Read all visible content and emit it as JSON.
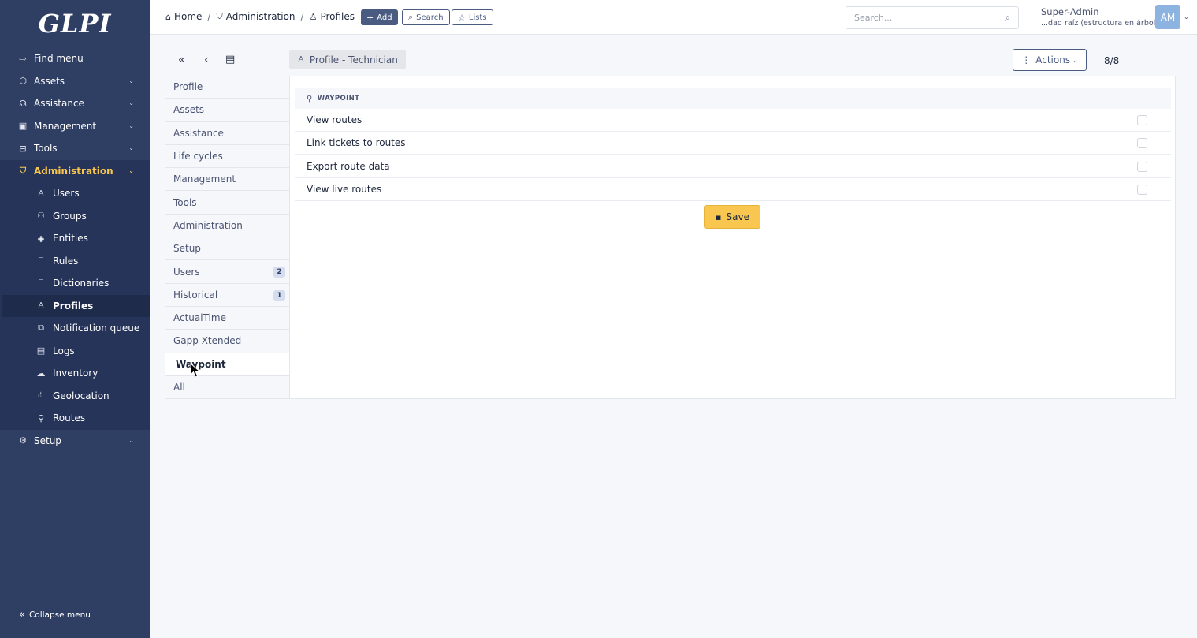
{
  "sidebar": {
    "logo": "GLPI",
    "items": [
      {
        "label": "Find menu",
        "icon": "arrow-icon",
        "glyph": "⇨",
        "chevron": false
      },
      {
        "label": "Assets",
        "icon": "box-icon",
        "glyph": "⬡",
        "chevron": true
      },
      {
        "label": "Assistance",
        "icon": "headset-icon",
        "glyph": "☊",
        "chevron": true
      },
      {
        "label": "Management",
        "icon": "wallet-icon",
        "glyph": "▣",
        "chevron": true
      },
      {
        "label": "Tools",
        "icon": "briefcase-icon",
        "glyph": "⊟",
        "chevron": true
      },
      {
        "label": "Administration",
        "icon": "shield-icon",
        "glyph": "⛉",
        "chevron": true,
        "active": true
      }
    ],
    "submenu": [
      {
        "label": "Users",
        "icon": "user-icon",
        "glyph": "♙"
      },
      {
        "label": "Groups",
        "icon": "users-icon",
        "glyph": "⚇"
      },
      {
        "label": "Entities",
        "icon": "layers-icon",
        "glyph": "◈"
      },
      {
        "label": "Rules",
        "icon": "book-icon",
        "glyph": "⎕"
      },
      {
        "label": "Dictionaries",
        "icon": "book-icon",
        "glyph": "⎕"
      },
      {
        "label": "Profiles",
        "icon": "user-check-icon",
        "glyph": "♙",
        "active": true
      },
      {
        "label": "Notification queue",
        "icon": "notification-icon",
        "glyph": "⧉"
      },
      {
        "label": "Logs",
        "icon": "log-icon",
        "glyph": "▤"
      },
      {
        "label": "Inventory",
        "icon": "cloud-download-icon",
        "glyph": "☁"
      },
      {
        "label": "Geolocation",
        "icon": "location-icon",
        "glyph": "⛙"
      },
      {
        "label": "Routes",
        "icon": "route-icon",
        "glyph": "⚲"
      }
    ],
    "setup": {
      "label": "Setup",
      "icon": "gear-icon",
      "glyph": "⚙"
    },
    "collapse_label": "Collapse menu"
  },
  "header": {
    "breadcrumb": {
      "home": "Home",
      "admin": "Administration",
      "profiles": "Profiles"
    },
    "add_label": "Add",
    "search_label": "Search",
    "lists_label": "Lists",
    "search_placeholder": "Search...",
    "user_name": "Super-Admin",
    "user_entity": "...dad raíz (estructura en árbol)",
    "avatar_initials": "AM"
  },
  "toolbar": {
    "profile_title": "Profile - Technician",
    "actions_label": "Actions",
    "counter": "8/8"
  },
  "tabs": [
    {
      "label": "Profile"
    },
    {
      "label": "Assets"
    },
    {
      "label": "Assistance"
    },
    {
      "label": "Life cycles"
    },
    {
      "label": "Management"
    },
    {
      "label": "Tools"
    },
    {
      "label": "Administration"
    },
    {
      "label": "Setup"
    },
    {
      "label": "Users",
      "badge": "2"
    },
    {
      "label": "Historical",
      "badge": "1"
    },
    {
      "label": "ActualTime"
    },
    {
      "label": "Gapp Xtended"
    },
    {
      "label": "Waypoint",
      "active": true
    },
    {
      "label": "All"
    }
  ],
  "panel": {
    "section_title": "WAYPOINT",
    "rights": [
      {
        "label": "View routes",
        "checked": false
      },
      {
        "label": "Link tickets to routes",
        "checked": false
      },
      {
        "label": "Export route data",
        "checked": false
      },
      {
        "label": "View live routes",
        "checked": false
      }
    ],
    "save_label": "Save"
  },
  "colors": {
    "sidebar": "#2f3f64",
    "accent": "#f9c74f",
    "primary": "#4a5b82"
  }
}
